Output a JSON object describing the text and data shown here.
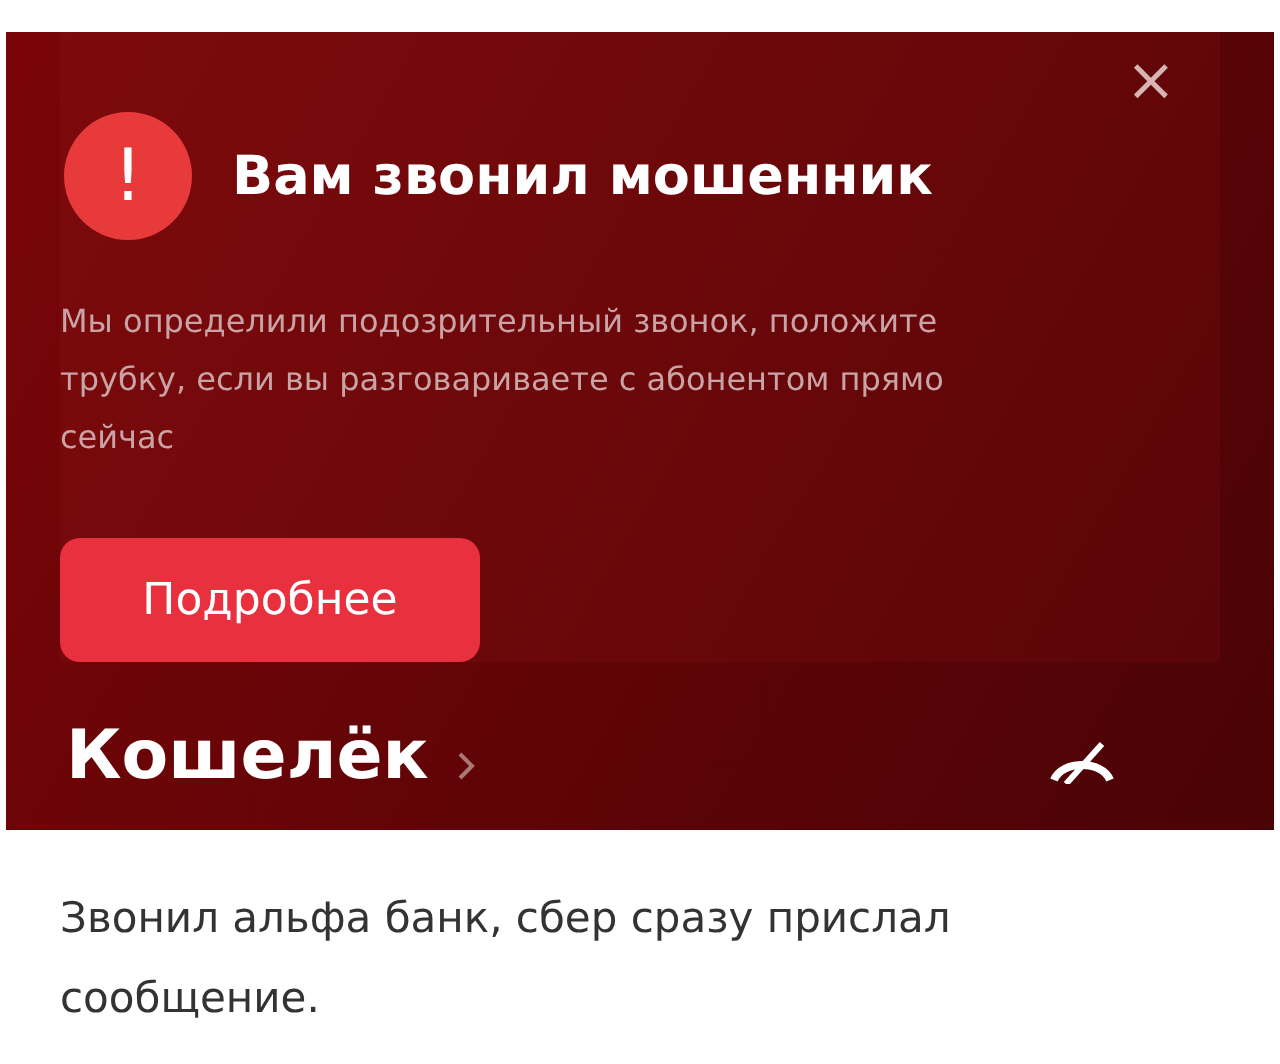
{
  "alert": {
    "close": "×",
    "icon": "!",
    "title": "Вам звонил мошенник",
    "message": "Мы определили подозрительный звонок, положите трубку, если вы разговариваете с абонентом прямо сейчас",
    "button": "Подробнее"
  },
  "section": {
    "title": "Кошелёк"
  },
  "caption": "Звонил альфа банк, сбер сразу прислал сообщение."
}
